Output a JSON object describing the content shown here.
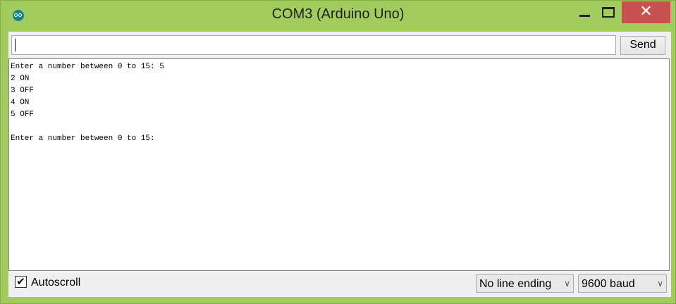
{
  "window": {
    "title": "COM3 (Arduino Uno)",
    "close_symbol": "✕",
    "accent": "#a3cc5e",
    "close_color": "#c75050"
  },
  "input": {
    "value": ""
  },
  "send_label": "Send",
  "output_lines": [
    "Enter a number between 0 to 15: 5",
    "2 ON",
    "3 OFF",
    "4 ON",
    "5 OFF",
    "",
    "Enter a number between 0 to 15:"
  ],
  "autoscroll": {
    "label": "Autoscroll",
    "checked": true,
    "mark": "✔"
  },
  "line_ending": {
    "selected": "No line ending"
  },
  "baud": {
    "selected": "9600 baud"
  },
  "chevron": "∨"
}
